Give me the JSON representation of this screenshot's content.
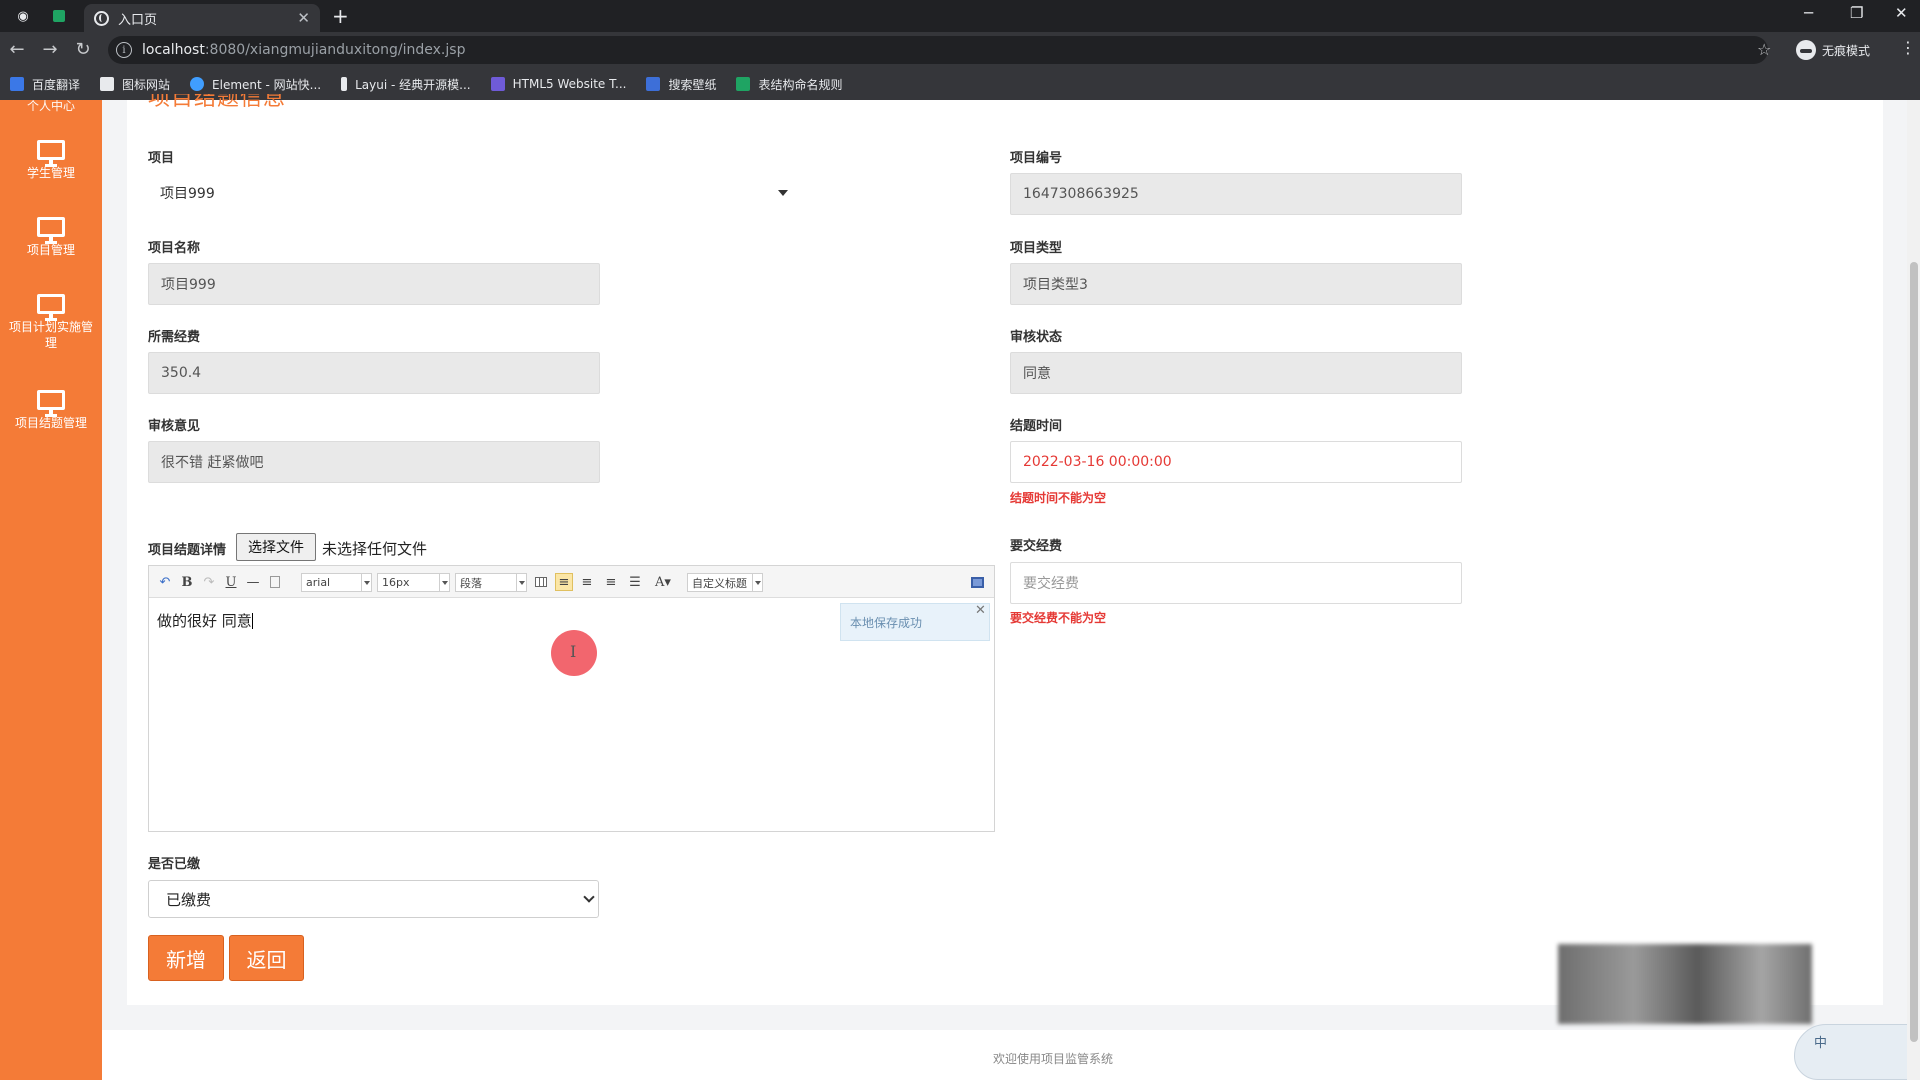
{
  "browser": {
    "tab_title": "入口页",
    "url_host": "localhost",
    "url_path": ":8080/xiangmujianduxitong/index.jsp",
    "profile_label": "无痕模式",
    "bookmarks": [
      {
        "label": "百度翻译",
        "color": "#3b78e7"
      },
      {
        "label": "图标网站",
        "color": "#e8eaed"
      },
      {
        "label": "Element - 网站快...",
        "color": "#409eff"
      },
      {
        "label": "Layui - 经典开源模...",
        "color": "#e8eaed"
      },
      {
        "label": "HTML5 Website T...",
        "color": "#6f5bd8"
      },
      {
        "label": "搜索壁纸",
        "color": "#3d6fd8"
      },
      {
        "label": "表结构命名规则",
        "color": "#1fa463"
      }
    ]
  },
  "sidebar": {
    "top_label": "个人中心",
    "items": [
      {
        "label": "学生管理"
      },
      {
        "label": "项目管理"
      },
      {
        "label": "项目计划实施管理"
      },
      {
        "label": "项目结题管理"
      }
    ]
  },
  "form": {
    "section_title": "项目结题信息",
    "project_label": "项目",
    "project_value": "项目999",
    "project_no_label": "项目编号",
    "project_no_value": "1647308663925",
    "project_name_label": "项目名称",
    "project_name_value": "项目999",
    "project_type_label": "项目类型",
    "project_type_value": "项目类型3",
    "budget_label": "所需经费",
    "budget_value": "350.4",
    "review_status_label": "审核状态",
    "review_status_value": "同意",
    "review_opinion_label": "审核意见",
    "review_opinion_value": "很不错 赶紧做吧",
    "end_time_label": "结题时间",
    "end_time_value": "2022-03-16 00:00:00",
    "end_time_error": "结题时间不能为空",
    "detail_label": "项目结题详情",
    "file_button": "选择文件",
    "file_status": "未选择任何文件",
    "fee_label": "要交经费",
    "fee_placeholder": "要交经费",
    "fee_error": "要交经费不能为空",
    "editor": {
      "font": "arial",
      "size": "16px",
      "paragraph": "段落",
      "custom_title": "自定义标题",
      "content": "做的很好  同意",
      "toast": "本地保存成功"
    },
    "paid_label": "是否已缴",
    "paid_value": "已缴费",
    "add_button": "新增",
    "back_button": "返回"
  },
  "footer": {
    "text": "欢迎使用项目监管系统"
  },
  "ime": {
    "label": "中"
  },
  "colors": {
    "accent": "#f47b37",
    "error": "#e53935"
  }
}
